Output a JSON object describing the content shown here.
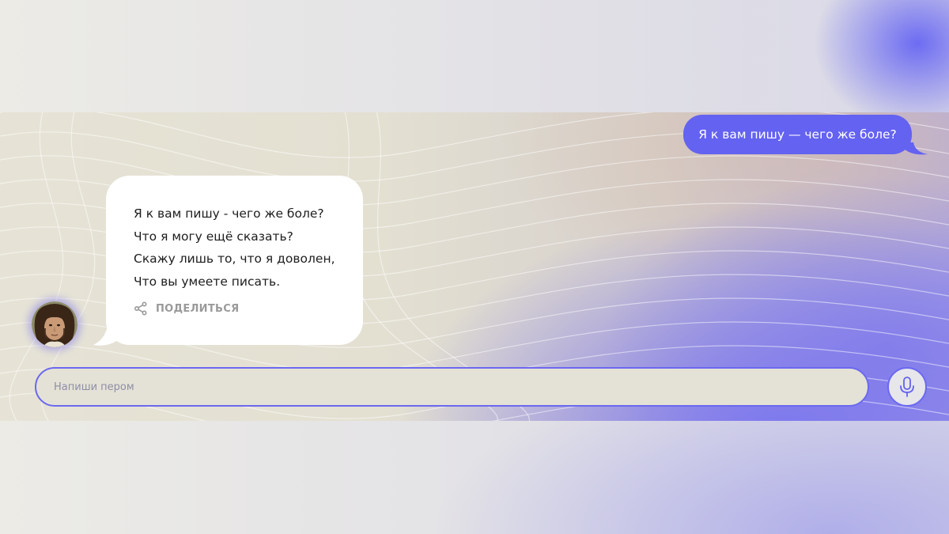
{
  "chat": {
    "user_message": "Я к вам пишу — чего же боле?",
    "bot_message": {
      "lines": [
        "Я к вам пишу - чего же боле?",
        "Что я могу ещё сказать?",
        "Скажу лишь то, что я доволен,",
        "Что вы умеете писать."
      ],
      "share_label": "ПОДЕЛИТЬСЯ",
      "share_icon": "share-icon"
    }
  },
  "composer": {
    "placeholder": "Напиши пером",
    "value": "",
    "mic_icon": "microphone-icon"
  },
  "colors": {
    "accent": "#6462f0",
    "user_bubble": "#6462f0",
    "bot_bubble": "#ffffff",
    "input_background": "#e4e2d6",
    "share_text": "#9a9a9a"
  }
}
